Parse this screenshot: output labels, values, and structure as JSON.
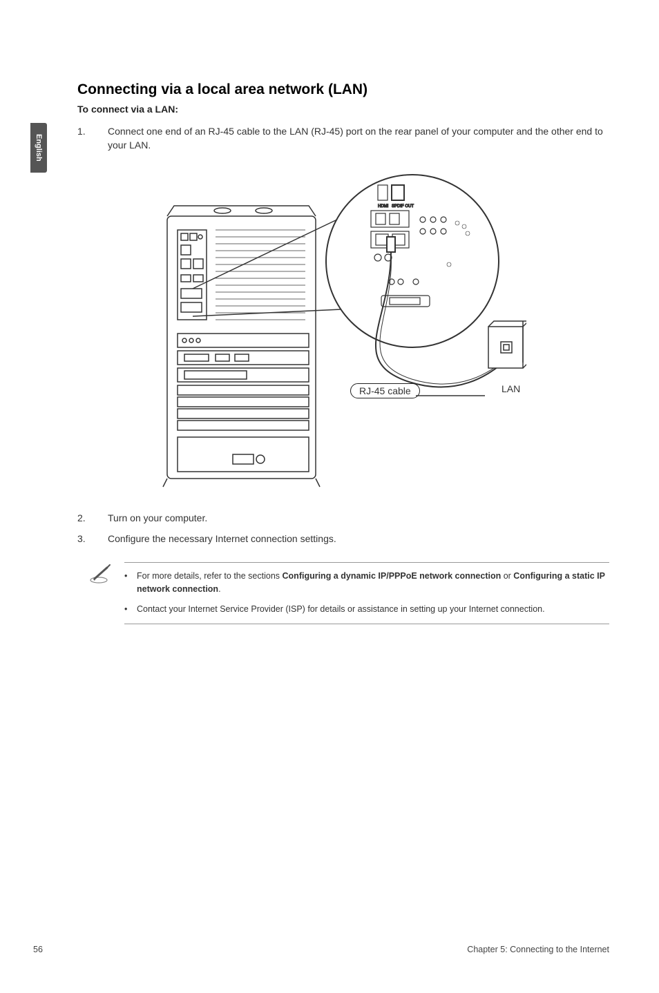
{
  "side_tab": "English",
  "section": {
    "title": "Connecting via a local area network (LAN)",
    "subtitle": "To connect via a LAN:",
    "steps": [
      {
        "num": "1.",
        "text": "Connect one end of an RJ-45 cable to the LAN (RJ-45) port on the rear panel of your computer and the other end to your LAN."
      },
      {
        "num": "2.",
        "text": "Turn on your computer."
      },
      {
        "num": "3.",
        "text": "Configure the necessary Internet connection settings."
      }
    ]
  },
  "diagram": {
    "cable_label": "RJ-45 cable",
    "socket_label": "LAN"
  },
  "notes": {
    "items": [
      {
        "prefix": "For more details, refer to the sections ",
        "bold1": "Configuring a dynamic IP/PPPoE network connection",
        "mid": " or ",
        "bold2": "Configuring a static IP network connection",
        "suffix": "."
      },
      {
        "text": "Contact your Internet Service Provider (ISP) for details or assistance in setting up your Internet connection."
      }
    ]
  },
  "footer": {
    "page": "56",
    "chapter": "Chapter 5: Connecting to the Internet"
  }
}
